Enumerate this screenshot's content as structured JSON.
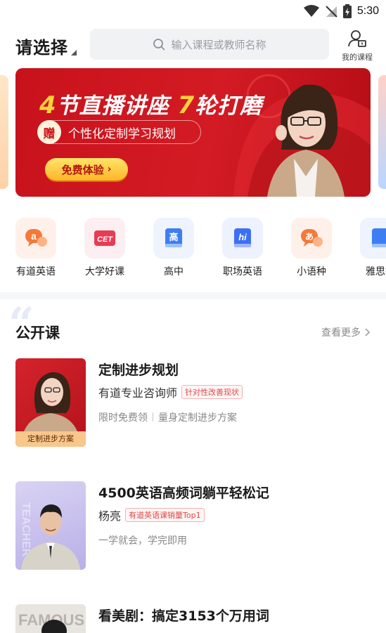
{
  "status_bar": {
    "time": "5:30"
  },
  "header": {
    "region_label": "请选择",
    "search_placeholder": "输入课程或教师名称",
    "my_courses_label": "我的课程"
  },
  "banner": {
    "headline_num1": "4",
    "headline_part1": "节直播讲座",
    "headline_num2": "7",
    "headline_part2": "轮打磨",
    "gift_badge": "赠",
    "gift_text": "个性化定制学习规划",
    "cta_label": "免费体验",
    "cta_arrow": "›"
  },
  "categories": [
    {
      "label": "有道英语",
      "icon": "youdao-english-icon",
      "glyph": "a",
      "color": "#f4793a",
      "bg": "#fff1ea"
    },
    {
      "label": "大学好课",
      "icon": "cet-icon",
      "glyph": "CET",
      "color": "#ea3a54",
      "bg": "#fdeef1"
    },
    {
      "label": "高中",
      "icon": "high-school-icon",
      "glyph": "高",
      "color": "#3d7ff2",
      "bg": "#eef3fe"
    },
    {
      "label": "职场英语",
      "icon": "workplace-english-icon",
      "glyph": "hi",
      "color": "#3d6ff2",
      "bg": "#eef1fe"
    },
    {
      "label": "小语种",
      "icon": "minor-language-icon",
      "glyph": "あ",
      "color": "#f4793a",
      "bg": "#fff1ea"
    },
    {
      "label": "雅思托",
      "icon": "ielts-icon",
      "glyph": "I",
      "color": "#3d7ff2",
      "bg": "#eef3fe"
    }
  ],
  "section": {
    "title": "公开课",
    "more_label": "查看更多"
  },
  "courses": [
    {
      "title": "定制进步规划",
      "teacher": "有道专业咨询师",
      "tag": "针对性改善现状",
      "desc_a": "限时免费领",
      "desc_b": "量身定制进步方案",
      "thumb_caption": "定制进步方案"
    },
    {
      "title": "4500英语高频词躺平轻松记",
      "teacher": "杨亮",
      "tag": "有道英语课销量Top1",
      "desc_a": "一学就会，学完即用",
      "thumb_watermark": "TEACHER"
    },
    {
      "title": "看美剧：搞定3153个万用词",
      "thumb_watermark": "FAMOUS"
    }
  ]
}
